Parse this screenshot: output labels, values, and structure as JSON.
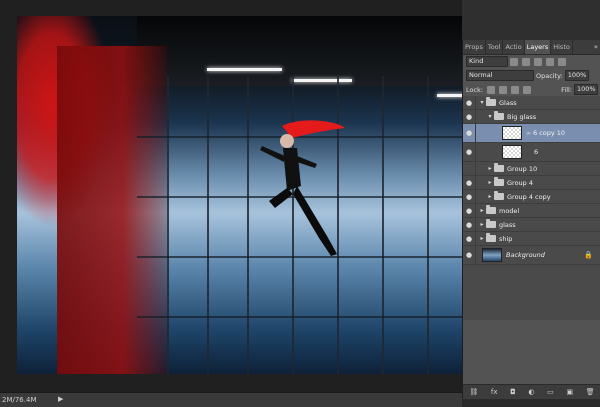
{
  "status": {
    "doc_size": "2M/76.4M",
    "arrow": "▶"
  },
  "panel": {
    "tabs": [
      "Props",
      "Tool",
      "Actio",
      "Layers",
      "Histo"
    ],
    "active_tab": "Layers",
    "menu_icon": "»",
    "filter_kind": "Kind",
    "blend_mode": "Normal",
    "opacity_label": "Opacity:",
    "opacity_value": "100%",
    "lock_label": "Lock:",
    "fill_label": "Fill:",
    "fill_value": "100%"
  },
  "layers": [
    {
      "name": "Glass",
      "type": "group",
      "indent": 0,
      "expanded": true,
      "visible": true
    },
    {
      "name": "Big glass",
      "type": "group",
      "indent": 1,
      "expanded": true,
      "visible": true
    },
    {
      "name": "6 copy 10",
      "type": "layer",
      "indent": 2,
      "selected": true,
      "visible": true
    },
    {
      "name": "6",
      "type": "layer",
      "indent": 2,
      "visible": true
    },
    {
      "name": "Group 10",
      "type": "group",
      "indent": 1,
      "expanded": false,
      "visible": false
    },
    {
      "name": "Group 4",
      "type": "group",
      "indent": 1,
      "expanded": false,
      "visible": true
    },
    {
      "name": "Group 4 copy",
      "type": "group",
      "indent": 1,
      "expanded": false,
      "visible": true
    },
    {
      "name": "model",
      "type": "group",
      "indent": 0,
      "expanded": false,
      "visible": true
    },
    {
      "name": "glass",
      "type": "group",
      "indent": 0,
      "expanded": false,
      "visible": true
    },
    {
      "name": "ship",
      "type": "group",
      "indent": 0,
      "expanded": false,
      "visible": true
    },
    {
      "name": "Background",
      "type": "background",
      "indent": 0,
      "visible": true,
      "locked": true
    }
  ],
  "bottom_icons": [
    "link-icon",
    "fx-icon",
    "mask-icon",
    "adjustment-icon",
    "new-group-icon",
    "new-layer-icon",
    "trash-icon"
  ],
  "bottom_glyphs": [
    "⛓",
    "fx",
    "◘",
    "◐",
    "▭",
    "▣",
    "🗑"
  ],
  "colors": {
    "selected_row": "#7a8fb0",
    "panel_bg": "#535353"
  }
}
